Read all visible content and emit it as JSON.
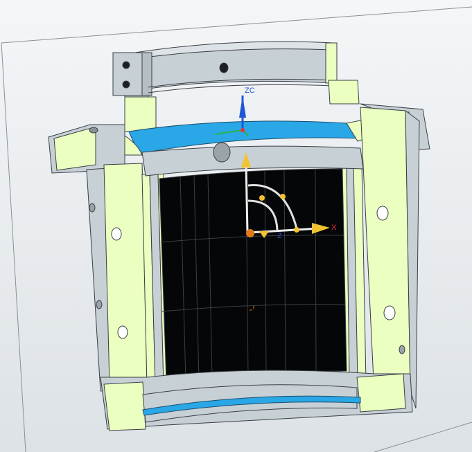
{
  "viewport": {
    "background_top": "#f4f6f8",
    "background_bottom": "#dde2e6"
  },
  "model": {
    "section_color": "#eaffc0",
    "body_color": "#c7d0d5",
    "edge_color": "#3a3f44",
    "seal_color": "#29a7e6",
    "bore_color": "#050607"
  },
  "triad": {
    "zc_label": "ZC",
    "x_label": "X",
    "z_label": "Z",
    "handle_color": "#f2c231",
    "origin_color": "#e2781a",
    "x_color": "#e53238",
    "zc_color": "#1f57d8"
  },
  "icons": [
    "rotate-handle-icon",
    "origin-icon",
    "crosshair-icon"
  ]
}
